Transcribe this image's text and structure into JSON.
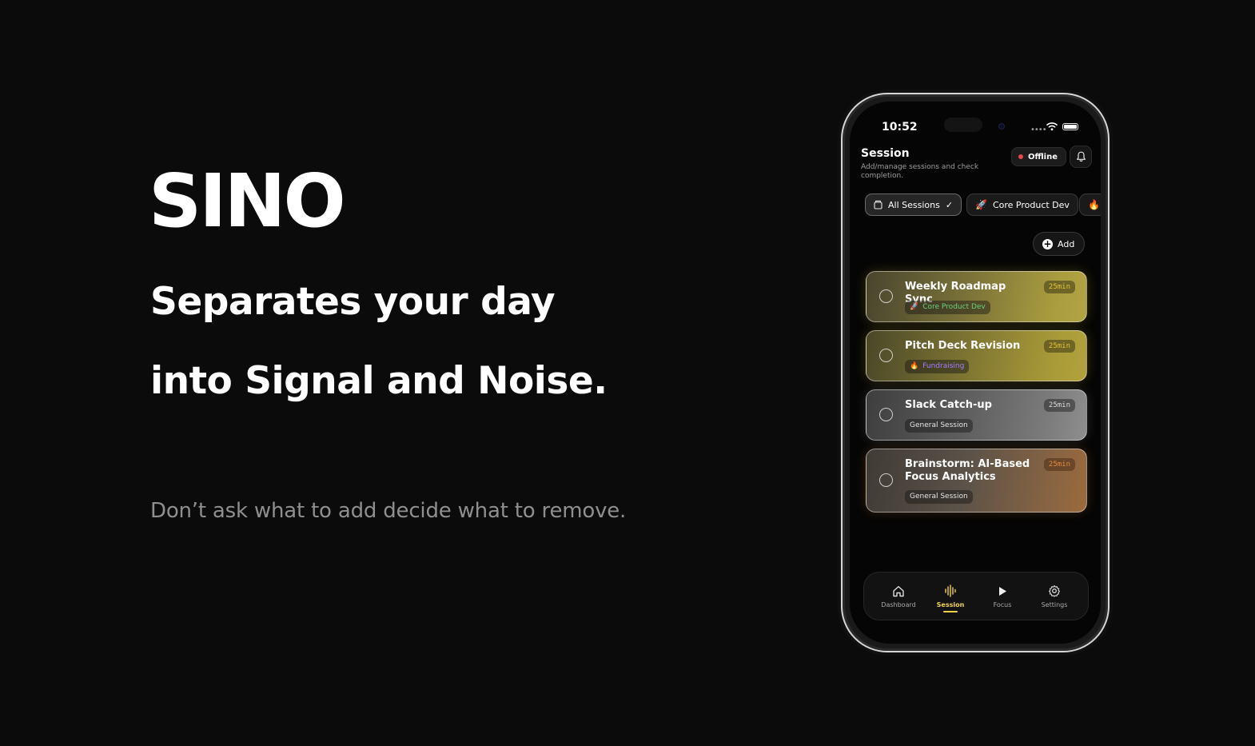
{
  "hero": {
    "brand": "SINO",
    "headline_line1": "Separates your day",
    "headline_line2": "into Signal and Noise.",
    "tagline": "Don’t ask what to add decide what to remove."
  },
  "phone": {
    "status_time": "10:52",
    "header": {
      "title": "Session",
      "subtitle": "Add/manage sessions and check completion.",
      "offline_label": "Offline",
      "offline_dot_color": "#e5484d"
    },
    "filters": [
      {
        "label": "All Sessions",
        "icon": "folder-icon",
        "selected": true
      },
      {
        "label": "Core Product Dev",
        "icon": "rocket-icon",
        "selected": false
      },
      {
        "label": "",
        "icon": "fire-icon",
        "selected": false
      }
    ],
    "add_label": "Add",
    "sessions": [
      {
        "title": "Weekly Roadmap Sync",
        "duration": "25min",
        "tag": "Core Product Dev",
        "tag_icon": "rocket-icon",
        "tag_color": "#6ed17a",
        "theme": "gold"
      },
      {
        "title": "Pitch Deck Revision",
        "duration": "25min",
        "tag": "Fundraising",
        "tag_icon": "fire-icon",
        "tag_color": "#a77dff",
        "theme": "gold"
      },
      {
        "title": "Slack Catch-up",
        "duration": "25min",
        "tag": "General Session",
        "tag_icon": "",
        "tag_color": "#e6e6e6",
        "theme": "grey"
      },
      {
        "title": "Brainstorm: AI-Based Focus Analytics",
        "duration": "25min",
        "tag": "General Session",
        "tag_icon": "",
        "tag_color": "#e6e6e6",
        "theme": "orange"
      }
    ],
    "tabs": [
      {
        "label": "Dashboard",
        "icon": "home-icon",
        "active": false
      },
      {
        "label": "Session",
        "icon": "waveform-icon",
        "active": true
      },
      {
        "label": "Focus",
        "icon": "play-icon",
        "active": false
      },
      {
        "label": "Settings",
        "icon": "gear-icon",
        "active": false
      }
    ],
    "accent_color": "#f1d34a"
  }
}
